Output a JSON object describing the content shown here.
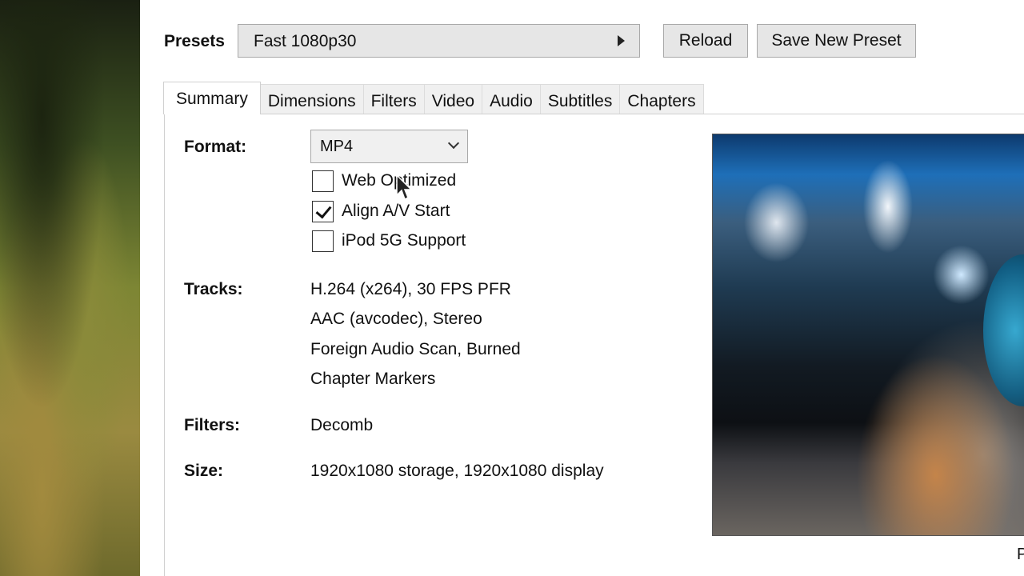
{
  "presets": {
    "label": "Presets",
    "selected": "Fast 1080p30",
    "reload_label": "Reload",
    "save_label": "Save New Preset"
  },
  "tabs": [
    {
      "label": "Summary",
      "active": true
    },
    {
      "label": "Dimensions"
    },
    {
      "label": "Filters"
    },
    {
      "label": "Video"
    },
    {
      "label": "Audio"
    },
    {
      "label": "Subtitles"
    },
    {
      "label": "Chapters"
    }
  ],
  "summary": {
    "format_label": "Format:",
    "format_value": "MP4",
    "options": [
      {
        "label": "Web Optimized",
        "checked": false
      },
      {
        "label": "Align A/V Start",
        "checked": true
      },
      {
        "label": "iPod 5G Support",
        "checked": false
      }
    ],
    "tracks_label": "Tracks:",
    "tracks": [
      "H.264 (x264), 30 FPS PFR",
      "AAC (avcodec), Stereo",
      "Foreign Audio Scan, Burned",
      "Chapter Markers"
    ],
    "filters_label": "Filters:",
    "filters_value": "Decomb",
    "size_label": "Size:",
    "size_value": "1920x1080 storage, 1920x1080 display",
    "corner_text": "P"
  },
  "colors": {
    "button_bg": "#e6e6e6",
    "border": "#a9a9a9"
  }
}
